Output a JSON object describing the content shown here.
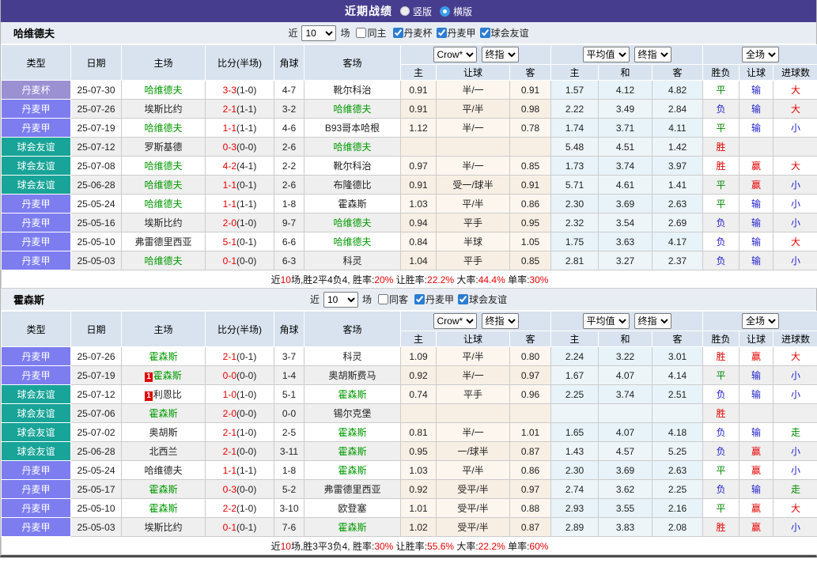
{
  "title_bar": {
    "title": "近期战绩",
    "view_options": [
      {
        "label": "竖版",
        "selected": false
      },
      {
        "label": "横版",
        "selected": true
      }
    ]
  },
  "filter": {
    "near_label": "近",
    "count": "10",
    "matches_label": "场"
  },
  "table_header": {
    "base_columns": [
      "类型",
      "日期",
      "主场",
      "比分(半场)",
      "角球",
      "客场"
    ],
    "odds_group": {
      "company_select": "Crow*",
      "final_select": "终指",
      "columns": [
        "主",
        "让球",
        "客"
      ]
    },
    "avg_group": {
      "avg_select": "平均值",
      "final_select": "终指",
      "columns": [
        "主",
        "和",
        "客"
      ]
    },
    "result_group": {
      "scope_select": "全场",
      "columns": [
        "胜负",
        "让球",
        "进球数"
      ]
    }
  },
  "colors": {
    "accent_purple": "#473d8f",
    "league_cup": "#9a90d2",
    "league_danish_1st": "#7d7df0",
    "club_friendly": "#18a498",
    "win_red": "#e60000",
    "draw_green": "#008800",
    "lose_blue": "#2222cc"
  },
  "teams": [
    {
      "name": "哈维德夫",
      "same_label": "同主",
      "leagues": [
        {
          "label": "丹麦杯",
          "checked": true
        },
        {
          "label": "丹麦甲",
          "checked": true
        },
        {
          "label": "球会友谊",
          "checked": true
        }
      ],
      "rows": [
        {
          "type": "丹麦杯",
          "type_key": "cup",
          "date": "25-07-30",
          "home": "哈维德夫",
          "home_hl": true,
          "home_rc": "",
          "score": "3-3",
          "half": "(1-0)",
          "corner": "4-7",
          "away": "靴尔科治",
          "away_hl": false,
          "away_rc": "",
          "odds": [
            "0.91",
            "半/一",
            "0.91"
          ],
          "avg": [
            "1.57",
            "4.12",
            "4.82"
          ],
          "res": [
            {
              "t": "平",
              "c": "green"
            },
            {
              "t": "输",
              "c": "blue"
            },
            {
              "t": "大",
              "c": "red"
            }
          ]
        },
        {
          "type": "丹麦甲",
          "type_key": "league",
          "date": "25-07-26",
          "home": "埃斯比约",
          "home_hl": false,
          "home_rc": "",
          "score": "2-1",
          "half": "(1-1)",
          "corner": "3-2",
          "away": "哈维德夫",
          "away_hl": true,
          "away_rc": "",
          "odds": [
            "0.91",
            "平/半",
            "0.98"
          ],
          "avg": [
            "2.22",
            "3.49",
            "2.84"
          ],
          "res": [
            {
              "t": "负",
              "c": "blue"
            },
            {
              "t": "输",
              "c": "blue"
            },
            {
              "t": "大",
              "c": "red"
            }
          ]
        },
        {
          "type": "丹麦甲",
          "type_key": "league",
          "date": "25-07-19",
          "home": "哈维德夫",
          "home_hl": true,
          "home_rc": "",
          "score": "1-1",
          "half": "(1-1)",
          "corner": "4-6",
          "away": "B93哥本哈根",
          "away_hl": false,
          "away_rc": "",
          "odds": [
            "1.12",
            "半/一",
            "0.78"
          ],
          "avg": [
            "1.74",
            "3.71",
            "4.11"
          ],
          "res": [
            {
              "t": "平",
              "c": "green"
            },
            {
              "t": "输",
              "c": "blue"
            },
            {
              "t": "小",
              "c": "blue"
            }
          ]
        },
        {
          "type": "球会友谊",
          "type_key": "friendly",
          "date": "25-07-12",
          "home": "罗斯基德",
          "home_hl": false,
          "home_rc": "",
          "score": "0-3",
          "half": "(0-0)",
          "corner": "2-6",
          "away": "哈维德夫",
          "away_hl": true,
          "away_rc": "",
          "odds": [
            "",
            "",
            ""
          ],
          "avg": [
            "5.48",
            "4.51",
            "1.42"
          ],
          "res": [
            {
              "t": "胜",
              "c": "red"
            },
            {
              "t": "",
              "c": ""
            },
            {
              "t": "",
              "c": ""
            }
          ]
        },
        {
          "type": "球会友谊",
          "type_key": "friendly",
          "date": "25-07-08",
          "home": "哈维德夫",
          "home_hl": true,
          "home_rc": "",
          "score": "4-2",
          "half": "(4-1)",
          "corner": "2-2",
          "away": "靴尔科治",
          "away_hl": false,
          "away_rc": "",
          "odds": [
            "0.97",
            "半/一",
            "0.85"
          ],
          "avg": [
            "1.73",
            "3.74",
            "3.97"
          ],
          "res": [
            {
              "t": "胜",
              "c": "red"
            },
            {
              "t": "赢",
              "c": "red"
            },
            {
              "t": "大",
              "c": "red"
            }
          ]
        },
        {
          "type": "球会友谊",
          "type_key": "friendly",
          "date": "25-06-28",
          "home": "哈维德夫",
          "home_hl": true,
          "home_rc": "",
          "score": "1-1",
          "half": "(0-1)",
          "corner": "2-6",
          "away": "布隆德比",
          "away_hl": false,
          "away_rc": "",
          "odds": [
            "0.91",
            "受一/球半",
            "0.91"
          ],
          "avg": [
            "5.71",
            "4.61",
            "1.41"
          ],
          "res": [
            {
              "t": "平",
              "c": "green"
            },
            {
              "t": "赢",
              "c": "red"
            },
            {
              "t": "小",
              "c": "blue"
            }
          ]
        },
        {
          "type": "丹麦甲",
          "type_key": "league",
          "date": "25-05-24",
          "home": "哈维德夫",
          "home_hl": true,
          "home_rc": "",
          "score": "1-1",
          "half": "(1-1)",
          "corner": "1-8",
          "away": "霍森斯",
          "away_hl": false,
          "away_rc": "",
          "odds": [
            "1.03",
            "平/半",
            "0.86"
          ],
          "avg": [
            "2.30",
            "3.69",
            "2.63"
          ],
          "res": [
            {
              "t": "平",
              "c": "green"
            },
            {
              "t": "输",
              "c": "blue"
            },
            {
              "t": "小",
              "c": "blue"
            }
          ]
        },
        {
          "type": "丹麦甲",
          "type_key": "league",
          "date": "25-05-16",
          "home": "埃斯比约",
          "home_hl": false,
          "home_rc": "",
          "score": "2-0",
          "half": "(1-0)",
          "corner": "9-7",
          "away": "哈维德夫",
          "away_hl": true,
          "away_rc": "",
          "odds": [
            "0.94",
            "平手",
            "0.95"
          ],
          "avg": [
            "2.32",
            "3.54",
            "2.69"
          ],
          "res": [
            {
              "t": "负",
              "c": "blue"
            },
            {
              "t": "输",
              "c": "blue"
            },
            {
              "t": "小",
              "c": "blue"
            }
          ]
        },
        {
          "type": "丹麦甲",
          "type_key": "league",
          "date": "25-05-10",
          "home": "弗雷德里西亚",
          "home_hl": false,
          "home_rc": "",
          "score": "5-1",
          "half": "(0-1)",
          "corner": "6-6",
          "away": "哈维德夫",
          "away_hl": true,
          "away_rc": "",
          "odds": [
            "0.84",
            "半球",
            "1.05"
          ],
          "avg": [
            "1.75",
            "3.63",
            "4.17"
          ],
          "res": [
            {
              "t": "负",
              "c": "blue"
            },
            {
              "t": "输",
              "c": "blue"
            },
            {
              "t": "大",
              "c": "red"
            }
          ]
        },
        {
          "type": "丹麦甲",
          "type_key": "league",
          "date": "25-05-03",
          "home": "哈维德夫",
          "home_hl": true,
          "home_rc": "",
          "score": "0-1",
          "half": "(0-0)",
          "corner": "6-3",
          "away": "科灵",
          "away_hl": false,
          "away_rc": "",
          "odds": [
            "1.04",
            "平手",
            "0.85"
          ],
          "avg": [
            "2.81",
            "3.27",
            "2.37"
          ],
          "res": [
            {
              "t": "负",
              "c": "blue"
            },
            {
              "t": "输",
              "c": "blue"
            },
            {
              "t": "小",
              "c": "blue"
            }
          ]
        }
      ],
      "summary": [
        {
          "text": "近",
          "red": false
        },
        {
          "text": "10",
          "red": true
        },
        {
          "text": "场,胜2平4负4, 胜率:",
          "red": false
        },
        {
          "text": "20%",
          "red": true
        },
        {
          "text": " 让胜率:",
          "red": false
        },
        {
          "text": "22.2%",
          "red": true
        },
        {
          "text": " 大率:",
          "red": false
        },
        {
          "text": "44.4%",
          "red": true
        },
        {
          "text": " 单率:",
          "red": false
        },
        {
          "text": "30%",
          "red": true
        }
      ]
    },
    {
      "name": "霍森斯",
      "same_label": "同客",
      "leagues": [
        {
          "label": "丹麦甲",
          "checked": true
        },
        {
          "label": "球会友谊",
          "checked": true
        }
      ],
      "rows": [
        {
          "type": "丹麦甲",
          "type_key": "league",
          "date": "25-07-26",
          "home": "霍森斯",
          "home_hl": true,
          "home_rc": "",
          "score": "2-1",
          "half": "(0-1)",
          "corner": "3-7",
          "away": "科灵",
          "away_hl": false,
          "away_rc": "",
          "odds": [
            "1.09",
            "平/半",
            "0.80"
          ],
          "avg": [
            "2.24",
            "3.22",
            "3.01"
          ],
          "res": [
            {
              "t": "胜",
              "c": "red"
            },
            {
              "t": "赢",
              "c": "red"
            },
            {
              "t": "大",
              "c": "red"
            }
          ]
        },
        {
          "type": "丹麦甲",
          "type_key": "league",
          "date": "25-07-19",
          "home": "霍森斯",
          "home_hl": true,
          "home_rc": "1",
          "score": "0-0",
          "half": "(0-0)",
          "corner": "1-4",
          "away": "奥胡斯费马",
          "away_hl": false,
          "away_rc": "",
          "odds": [
            "0.92",
            "半/一",
            "0.97"
          ],
          "avg": [
            "1.67",
            "4.07",
            "4.14"
          ],
          "res": [
            {
              "t": "平",
              "c": "green"
            },
            {
              "t": "输",
              "c": "blue"
            },
            {
              "t": "小",
              "c": "blue"
            }
          ]
        },
        {
          "type": "球会友谊",
          "type_key": "friendly",
          "date": "25-07-12",
          "home": "利恩比",
          "home_hl": false,
          "home_rc": "1",
          "score": "1-0",
          "half": "(1-0)",
          "corner": "5-1",
          "away": "霍森斯",
          "away_hl": true,
          "away_rc": "",
          "odds": [
            "0.74",
            "平手",
            "0.96"
          ],
          "avg": [
            "2.25",
            "3.74",
            "2.51"
          ],
          "res": [
            {
              "t": "负",
              "c": "blue"
            },
            {
              "t": "输",
              "c": "blue"
            },
            {
              "t": "小",
              "c": "blue"
            }
          ]
        },
        {
          "type": "球会友谊",
          "type_key": "friendly",
          "date": "25-07-06",
          "home": "霍森斯",
          "home_hl": true,
          "home_rc": "",
          "score": "2-0",
          "half": "(0-0)",
          "corner": "0-0",
          "away": "锡尔克堡",
          "away_hl": false,
          "away_rc": "",
          "odds": [
            "",
            "",
            ""
          ],
          "avg": [
            "",
            "",
            ""
          ],
          "res": [
            {
              "t": "胜",
              "c": "red"
            },
            {
              "t": "",
              "c": ""
            },
            {
              "t": "",
              "c": ""
            }
          ]
        },
        {
          "type": "球会友谊",
          "type_key": "friendly",
          "date": "25-07-02",
          "home": "奥胡斯",
          "home_hl": false,
          "home_rc": "",
          "score": "2-1",
          "half": "(1-0)",
          "corner": "2-5",
          "away": "霍森斯",
          "away_hl": true,
          "away_rc": "",
          "odds": [
            "0.81",
            "半/一",
            "1.01"
          ],
          "avg": [
            "1.65",
            "4.07",
            "4.18"
          ],
          "res": [
            {
              "t": "负",
              "c": "blue"
            },
            {
              "t": "输",
              "c": "blue"
            },
            {
              "t": "走",
              "c": "green"
            }
          ]
        },
        {
          "type": "球会友谊",
          "type_key": "friendly",
          "date": "25-06-28",
          "home": "北西兰",
          "home_hl": false,
          "home_rc": "",
          "score": "2-1",
          "half": "(0-0)",
          "corner": "3-11",
          "away": "霍森斯",
          "away_hl": true,
          "away_rc": "",
          "odds": [
            "0.95",
            "一/球半",
            "0.87"
          ],
          "avg": [
            "1.43",
            "4.57",
            "5.25"
          ],
          "res": [
            {
              "t": "负",
              "c": "blue"
            },
            {
              "t": "赢",
              "c": "red"
            },
            {
              "t": "小",
              "c": "blue"
            }
          ]
        },
        {
          "type": "丹麦甲",
          "type_key": "league",
          "date": "25-05-24",
          "home": "哈维德夫",
          "home_hl": false,
          "home_rc": "",
          "score": "1-1",
          "half": "(1-1)",
          "corner": "1-8",
          "away": "霍森斯",
          "away_hl": true,
          "away_rc": "",
          "odds": [
            "1.03",
            "平/半",
            "0.86"
          ],
          "avg": [
            "2.30",
            "3.69",
            "2.63"
          ],
          "res": [
            {
              "t": "平",
              "c": "green"
            },
            {
              "t": "赢",
              "c": "red"
            },
            {
              "t": "小",
              "c": "blue"
            }
          ]
        },
        {
          "type": "丹麦甲",
          "type_key": "league",
          "date": "25-05-17",
          "home": "霍森斯",
          "home_hl": true,
          "home_rc": "",
          "score": "0-3",
          "half": "(0-0)",
          "corner": "5-2",
          "away": "弗雷德里西亚",
          "away_hl": false,
          "away_rc": "",
          "odds": [
            "0.92",
            "受平/半",
            "0.97"
          ],
          "avg": [
            "2.74",
            "3.62",
            "2.25"
          ],
          "res": [
            {
              "t": "负",
              "c": "blue"
            },
            {
              "t": "输",
              "c": "blue"
            },
            {
              "t": "走",
              "c": "green"
            }
          ]
        },
        {
          "type": "丹麦甲",
          "type_key": "league",
          "date": "25-05-10",
          "home": "霍森斯",
          "home_hl": true,
          "home_rc": "",
          "score": "2-2",
          "half": "(1-0)",
          "corner": "3-10",
          "away": "欧登塞",
          "away_hl": false,
          "away_rc": "",
          "odds": [
            "1.01",
            "受平/半",
            "0.88"
          ],
          "avg": [
            "2.93",
            "3.55",
            "2.16"
          ],
          "res": [
            {
              "t": "平",
              "c": "green"
            },
            {
              "t": "赢",
              "c": "red"
            },
            {
              "t": "大",
              "c": "red"
            }
          ]
        },
        {
          "type": "丹麦甲",
          "type_key": "league",
          "date": "25-05-03",
          "home": "埃斯比约",
          "home_hl": false,
          "home_rc": "",
          "score": "0-1",
          "half": "(0-1)",
          "corner": "7-6",
          "away": "霍森斯",
          "away_hl": true,
          "away_rc": "",
          "odds": [
            "1.02",
            "受平/半",
            "0.87"
          ],
          "avg": [
            "2.89",
            "3.83",
            "2.08"
          ],
          "res": [
            {
              "t": "胜",
              "c": "red"
            },
            {
              "t": "赢",
              "c": "red"
            },
            {
              "t": "小",
              "c": "blue"
            }
          ]
        }
      ],
      "summary": [
        {
          "text": "近",
          "red": false
        },
        {
          "text": "10",
          "red": true
        },
        {
          "text": "场,胜3平3负4, 胜率:",
          "red": false
        },
        {
          "text": "30%",
          "red": true
        },
        {
          "text": " 让胜率:",
          "red": false
        },
        {
          "text": "55.6%",
          "red": true
        },
        {
          "text": " 大率:",
          "red": false
        },
        {
          "text": "22.2%",
          "red": true
        },
        {
          "text": " 单率:",
          "red": false
        },
        {
          "text": "60%",
          "red": true
        }
      ]
    }
  ]
}
